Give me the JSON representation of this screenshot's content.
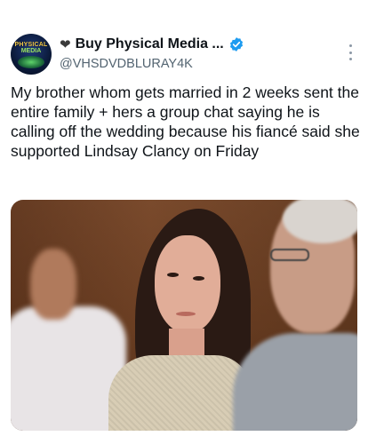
{
  "author": {
    "display_name": "Buy Physical Media ...",
    "handle": "@VHSDVDBLURAY4K",
    "avatar_text_top": "PHYSICAL",
    "avatar_text_bottom": "MEDIA",
    "heart_icon": "black-heart-icon",
    "verified_icon": "verified-badge-icon"
  },
  "post": {
    "text": "My brother whom gets married in 2 weeks sent the entire family + hers a group chat saying he is calling off the wedding because his fiancé said she supported Lindsay Clancy on Friday"
  },
  "colors": {
    "text_primary": "#0f1419",
    "text_secondary": "#536471",
    "verified_blue": "#1d9bf0"
  }
}
